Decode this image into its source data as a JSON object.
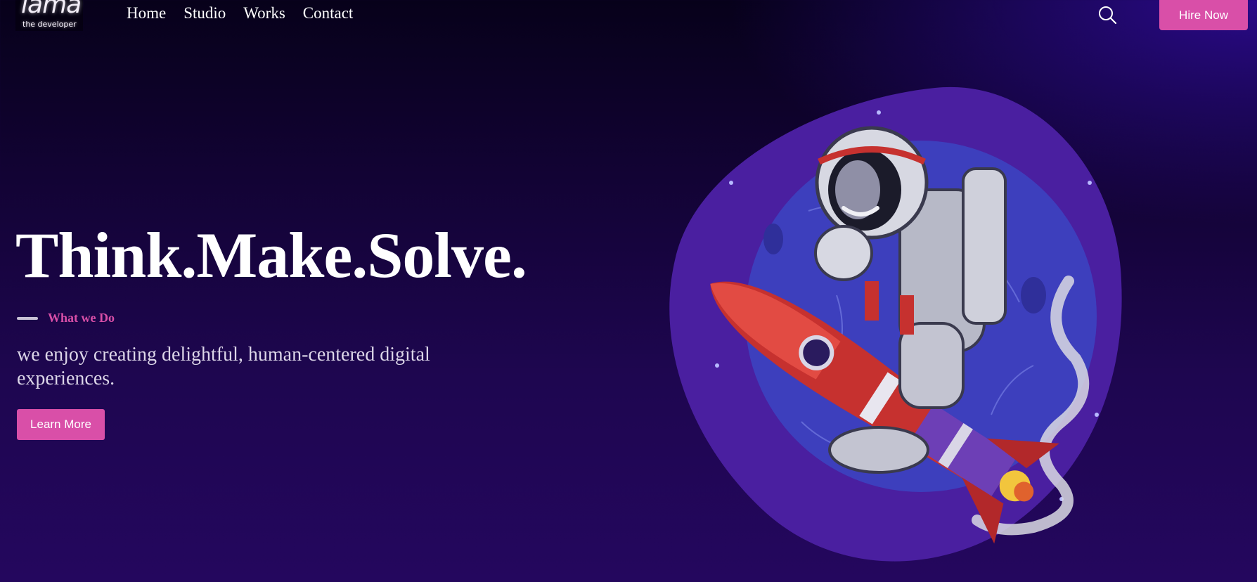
{
  "nav": {
    "logo": {
      "script": "lama",
      "sub": "the developer"
    },
    "links": [
      "Home",
      "Studio",
      "Works",
      "Contact"
    ],
    "search_icon": "search-icon",
    "hire_label": "Hire Now"
  },
  "hero": {
    "title": "Think.Make.Solve.",
    "eyebrow": "What we Do",
    "tagline": "we enjoy creating delightful, human-centered digital experiences.",
    "cta_label": "Learn More"
  },
  "illustration": {
    "subject": "astronaut-riding-rocket"
  },
  "colors": {
    "accent": "#d94fa8",
    "bg_dark": "#07011a",
    "bg_purple": "#1e0650",
    "blob": "#5a2ab0",
    "planet": "#3d3fbd"
  }
}
